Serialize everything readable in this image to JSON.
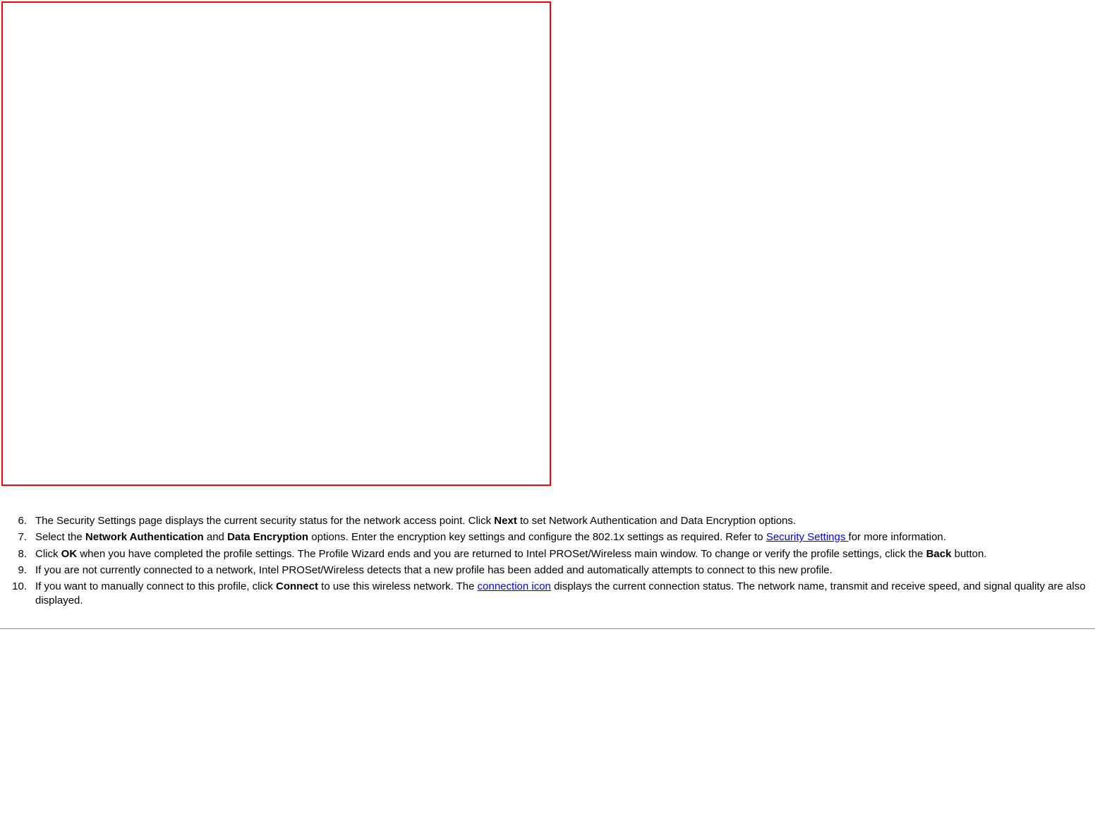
{
  "items": [
    {
      "parts": [
        {
          "t": "text",
          "v": "The Security Settings page displays the current security status for the network access point. Click "
        },
        {
          "t": "bold",
          "v": "Next"
        },
        {
          "t": "text",
          "v": " to set Network Authentication and Data Encryption options."
        }
      ]
    },
    {
      "parts": [
        {
          "t": "text",
          "v": "Select the "
        },
        {
          "t": "bold",
          "v": "Network Authentication"
        },
        {
          "t": "text",
          "v": " and "
        },
        {
          "t": "bold",
          "v": "Data Encryption"
        },
        {
          "t": "text",
          "v": " options. Enter the encryption key settings and configure the 802.1x settings as required. Refer to "
        },
        {
          "t": "link",
          "v": "Security Settings "
        },
        {
          "t": "text",
          "v": "for more information."
        }
      ]
    },
    {
      "parts": [
        {
          "t": "text",
          "v": "Click "
        },
        {
          "t": "bold",
          "v": "OK"
        },
        {
          "t": "text",
          "v": " when you have completed the profile settings. The Profile Wizard ends and you are returned to Intel PROSet/Wireless main window. To change or verify the profile settings, click the "
        },
        {
          "t": "bold",
          "v": "Back"
        },
        {
          "t": "text",
          "v": " button."
        }
      ]
    },
    {
      "parts": [
        {
          "t": "text",
          "v": "If you are not currently connected to a network, Intel PROSet/Wireless detects that a new profile has been added and automatically attempts to connect to this new profile."
        }
      ]
    },
    {
      "parts": [
        {
          "t": "text",
          "v": "If you want to manually connect to this profile, click "
        },
        {
          "t": "bold",
          "v": "Connect"
        },
        {
          "t": "text",
          "v": " to use this wireless network. The "
        },
        {
          "t": "link",
          "v": "connection icon"
        },
        {
          "t": "text",
          "v": " displays the current connection status. The network name, transmit and receive speed, and signal quality are also displayed."
        }
      ]
    }
  ]
}
